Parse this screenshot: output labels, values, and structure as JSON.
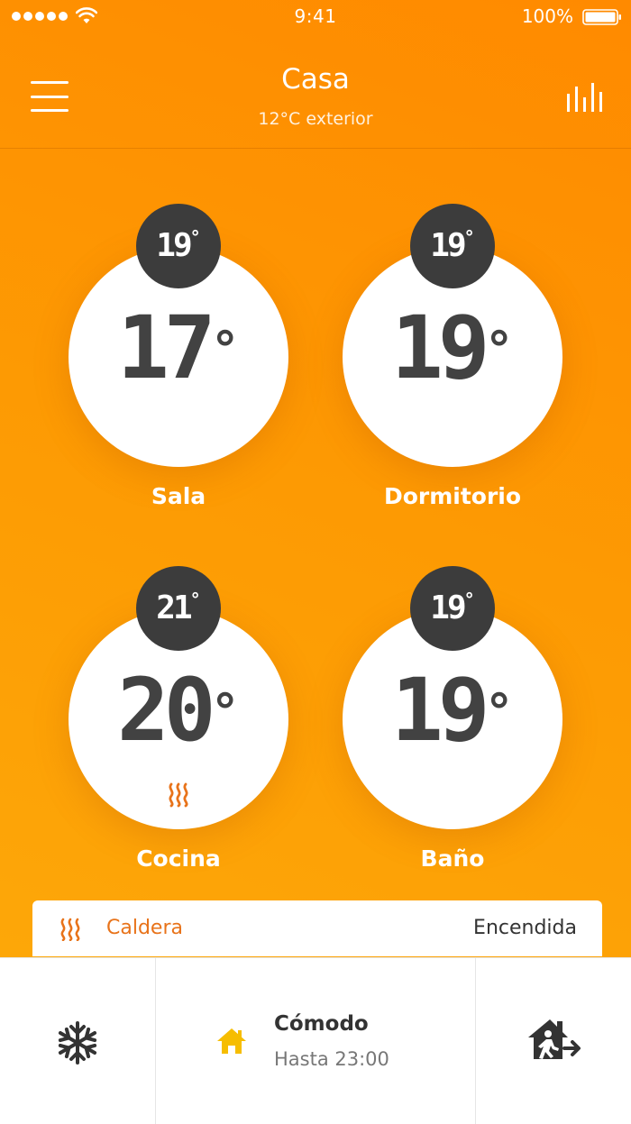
{
  "status_bar": {
    "time": "9:41",
    "battery": "100%"
  },
  "header": {
    "title": "Casa",
    "subtitle": "12°C exterior"
  },
  "rooms": [
    {
      "name": "Sala",
      "current": "17",
      "target": "19",
      "heating": false
    },
    {
      "name": "Dormitorio",
      "current": "19",
      "target": "19",
      "heating": false
    },
    {
      "name": "Cocina",
      "current": "20",
      "target": "21",
      "heating": true
    },
    {
      "name": "Baño",
      "current": "19",
      "target": "19",
      "heating": false
    }
  ],
  "degree_symbol": "°",
  "boiler": {
    "label": "Caldera",
    "status": "Encendida"
  },
  "mode": {
    "name": "Cómodo",
    "until": "Hasta 23:00"
  },
  "icons": {
    "menu": "hamburger-icon",
    "stats": "bar-chart-icon",
    "heating": "heat-waves-icon",
    "frost": "snowflake-icon",
    "mode": "home-icon",
    "away": "leave-home-icon"
  },
  "colors": {
    "accent": "#ff8c00",
    "dark": "#3c3c3c",
    "boiler_text": "#e8731a",
    "home_icon": "#f6bd00"
  }
}
